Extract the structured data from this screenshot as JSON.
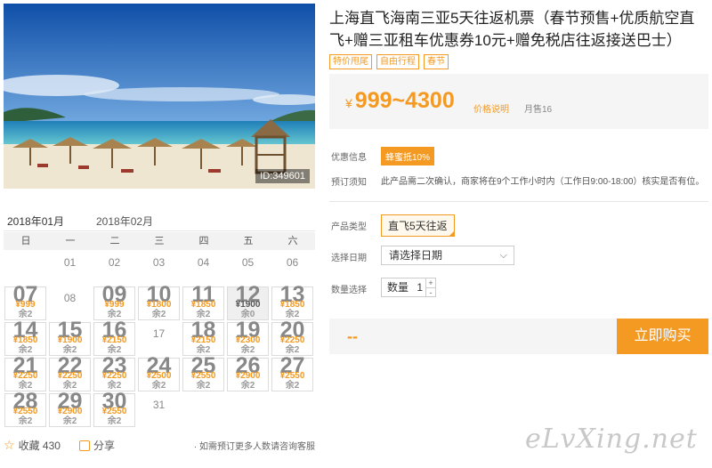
{
  "photo": {
    "id_label": "ID:349601"
  },
  "product": {
    "title": "上海直飞海南三亚5天往返机票（春节预售+优质航空直飞+赠三亚租车优惠券10元+赠免税店往返接送巴士）",
    "tags": [
      "特价甩尾",
      "自由行程",
      "春节"
    ],
    "price_currency": "¥",
    "price_range": "999~4300",
    "price_note": "价格说明",
    "monthly_sales": "月售16"
  },
  "info": {
    "promo_label": "优惠信息",
    "promo_badge": "蜂蜜抵10%",
    "notice_label": "预订须知",
    "notice_text": "此产品需二次确认，商家将在9个工作小时内（工作日9:00-18:00）核实是否有位。"
  },
  "options": {
    "type_label": "产品类型",
    "type_value": "直飞5天往返",
    "date_label": "选择日期",
    "date_placeholder": "请选择日期",
    "qty_label": "数量选择",
    "qty_text": "数量",
    "qty_value": "1"
  },
  "buy": {
    "dash": "--",
    "button": "立即购买"
  },
  "calendar": {
    "months": [
      "2018年01月",
      "2018年02月"
    ],
    "weekdays": [
      "日",
      "一",
      "二",
      "三",
      "四",
      "五",
      "六"
    ],
    "cells": [
      {
        "d": "01"
      },
      {
        "d": "02"
      },
      {
        "d": "03"
      },
      {
        "d": "04"
      },
      {
        "d": "05"
      },
      {
        "d": "06"
      },
      {
        "d": "07",
        "p": "¥999",
        "s": "余2"
      },
      {
        "d": "08"
      },
      {
        "d": "09",
        "p": "¥999",
        "s": "余2"
      },
      {
        "d": "10",
        "p": "¥1800",
        "s": "余2"
      },
      {
        "d": "11",
        "p": "¥1850",
        "s": "余2"
      },
      {
        "d": "12",
        "p": "¥1900",
        "s": "余0"
      },
      {
        "d": "13",
        "p": "¥1850",
        "s": "余2"
      },
      {
        "d": "14",
        "p": "¥1850",
        "s": "余2"
      },
      {
        "d": "15",
        "p": "¥1900",
        "s": "余2"
      },
      {
        "d": "16",
        "p": "¥2150",
        "s": "余2"
      },
      {
        "d": "17"
      },
      {
        "d": "18",
        "p": "¥2150",
        "s": "余2"
      },
      {
        "d": "19",
        "p": "¥2300",
        "s": "余2"
      },
      {
        "d": "20",
        "p": "¥2250",
        "s": "余2"
      },
      {
        "d": "21",
        "p": "¥2250",
        "s": "余2"
      },
      {
        "d": "22",
        "p": "¥2250",
        "s": "余2"
      },
      {
        "d": "23",
        "p": "¥2250",
        "s": "余2"
      },
      {
        "d": "24",
        "p": "¥2500",
        "s": "余2"
      },
      {
        "d": "25",
        "p": "¥2550",
        "s": "余2"
      },
      {
        "d": "26",
        "p": "¥2900",
        "s": "余2"
      },
      {
        "d": "27",
        "p": "¥2550",
        "s": "余2"
      },
      {
        "d": "28",
        "p": "¥2550",
        "s": "余2"
      },
      {
        "d": "29",
        "p": "¥2900",
        "s": "余2"
      },
      {
        "d": "30",
        "p": "¥2550",
        "s": "余2"
      },
      {
        "d": "31"
      }
    ]
  },
  "footer": {
    "favorite": "收藏 430",
    "share": "分享",
    "note": "· 如需预订更多人数请咨询客服"
  },
  "watermark": "eLvXing.net"
}
